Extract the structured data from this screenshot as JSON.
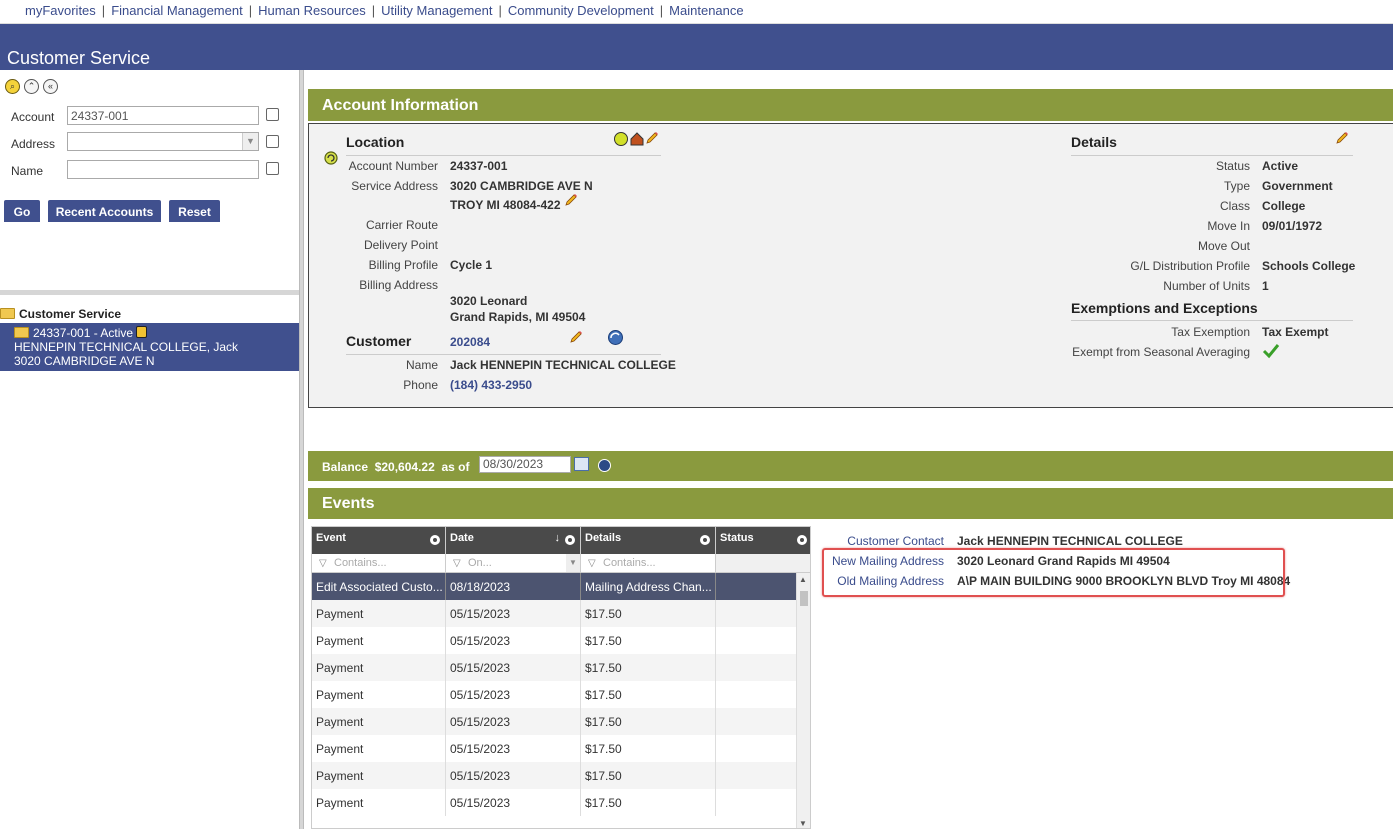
{
  "topnav": {
    "items": [
      "myFavorites",
      "Financial Management",
      "Human Resources",
      "Utility Management",
      "Community Development",
      "Maintenance"
    ],
    "separator": "|"
  },
  "header": {
    "title": "Customer Service"
  },
  "search": {
    "account_label": "Account",
    "account_value": "24337-001",
    "address_label": "Address",
    "address_value": "",
    "name_label": "Name",
    "name_value": "",
    "buttons": {
      "go": "Go",
      "recent": "Recent Accounts",
      "reset": "Reset"
    }
  },
  "tree": {
    "root_label": "Customer Service",
    "selected": {
      "line1": "24337-001 - Active",
      "line2": "HENNEPIN TECHNICAL COLLEGE, Jack",
      "line3": "3020 CAMBRIDGE AVE N"
    }
  },
  "account_info": {
    "bar_title": "Account Information",
    "location": {
      "title": "Location",
      "account_number_label": "Account Number",
      "account_number": "24337-001",
      "service_address_label": "Service Address",
      "service_address_1": "3020 CAMBRIDGE AVE N",
      "service_address_2": "TROY MI 48084-422",
      "carrier_route_label": "Carrier Route",
      "delivery_point_label": "Delivery Point",
      "billing_profile_label": "Billing Profile",
      "billing_profile": "Cycle 1",
      "billing_address_label": "Billing Address",
      "billing_address_1": "3020 Leonard",
      "billing_address_2": "Grand Rapids, MI 49504"
    },
    "customer": {
      "title": "Customer",
      "id": "202084",
      "name_label": "Name",
      "name": "Jack HENNEPIN TECHNICAL COLLEGE",
      "phone_label": "Phone",
      "phone": "(184) 433-2950"
    },
    "details": {
      "title": "Details",
      "status_label": "Status",
      "status": "Active",
      "type_label": "Type",
      "type": "Government",
      "class_label": "Class",
      "class": "College",
      "move_in_label": "Move In",
      "move_in": "09/01/1972",
      "move_out_label": "Move Out",
      "gl_label": "G/L Distribution Profile",
      "gl": "Schools College",
      "units_label": "Number of Units",
      "units": "1"
    },
    "exemptions": {
      "title": "Exemptions and Exceptions",
      "tax_label": "Tax Exemption",
      "tax": "Tax Exempt",
      "seasonal_label": "Exempt from Seasonal Averaging"
    }
  },
  "balance": {
    "label": "Balance",
    "amount": "$20,604.22",
    "as_of_label": "as of",
    "date": "08/30/2023"
  },
  "events": {
    "bar_title": "Events",
    "columns": [
      "Event",
      "Date",
      "Details",
      "Status"
    ],
    "filter_placeholders": [
      "Contains...",
      "On...",
      "Contains..."
    ],
    "rows": [
      [
        "Edit Associated Custo...",
        "08/18/2023",
        "Mailing Address Chan...",
        ""
      ],
      [
        "Payment",
        "05/15/2023",
        "$17.50",
        ""
      ],
      [
        "Payment",
        "05/15/2023",
        "$17.50",
        ""
      ],
      [
        "Payment",
        "05/15/2023",
        "$17.50",
        ""
      ],
      [
        "Payment",
        "05/15/2023",
        "$17.50",
        ""
      ],
      [
        "Payment",
        "05/15/2023",
        "$17.50",
        ""
      ],
      [
        "Payment",
        "05/15/2023",
        "$17.50",
        ""
      ],
      [
        "Payment",
        "05/15/2023",
        "$17.50",
        ""
      ],
      [
        "Payment",
        "05/15/2023",
        "$17.50",
        ""
      ]
    ],
    "detail": {
      "contact_label": "Customer Contact",
      "contact": "Jack HENNEPIN TECHNICAL COLLEGE",
      "new_label": "New Mailing Address",
      "new": "3020 Leonard Grand Rapids MI 49504",
      "old_label": "Old Mailing Address",
      "old": "A\\P MAIN BUILDING 9000 BROOKLYN BLVD Troy MI 48084"
    }
  },
  "colors": {
    "header_blue": "#40508e",
    "olive_bar": "#8a9a3e",
    "highlight_red": "#e05050"
  }
}
